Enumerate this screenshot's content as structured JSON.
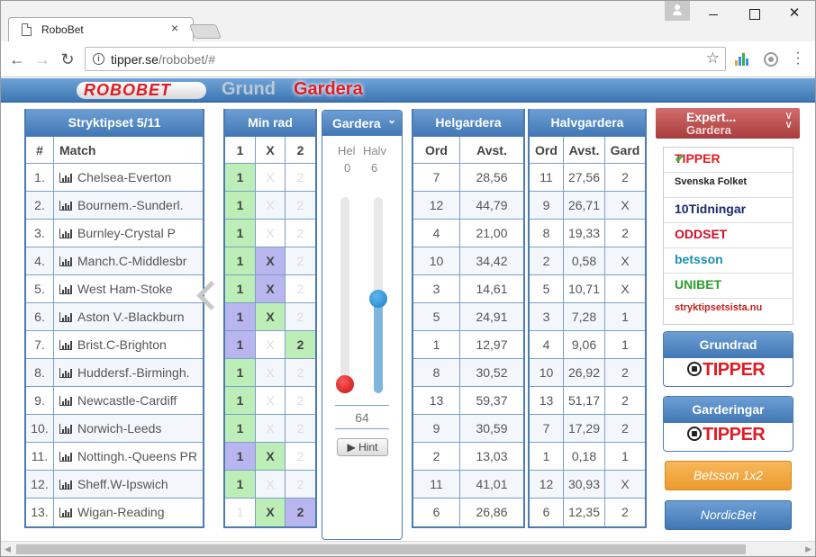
{
  "browser": {
    "tab_title": "RoboBet",
    "tab_close": "×",
    "url_domain": "tipper.se",
    "url_path": "/robobet/#",
    "win_close": "✕"
  },
  "header": {
    "logo": "ROBOBET",
    "mode_grund": "Grund",
    "mode_gardera": "Gardera"
  },
  "match_panel": {
    "title": "Stryktipset 5/11",
    "col_num": "#",
    "col_match": "Match",
    "rows": [
      {
        "num": "1.",
        "match": "Chelsea-Everton"
      },
      {
        "num": "2.",
        "match": "Bournem.-Sunderl."
      },
      {
        "num": "3.",
        "match": "Burnley-Crystal P"
      },
      {
        "num": "4.",
        "match": "Manch.C-Middlesbr"
      },
      {
        "num": "5.",
        "match": "West Ham-Stoke"
      },
      {
        "num": "6.",
        "match": "Aston V.-Blackburn"
      },
      {
        "num": "7.",
        "match": "Brist.C-Brighton"
      },
      {
        "num": "8.",
        "match": "Huddersf.-Birmingh."
      },
      {
        "num": "9.",
        "match": "Newcastle-Cardiff"
      },
      {
        "num": "10.",
        "match": "Norwich-Leeds"
      },
      {
        "num": "11.",
        "match": "Nottingh.-Queens PR"
      },
      {
        "num": "12.",
        "match": "Sheff.W-Ipswich"
      },
      {
        "num": "13.",
        "match": "Wigan-Reading"
      }
    ]
  },
  "minrad_panel": {
    "title": "Min rad",
    "cols": [
      "1",
      "X",
      "2"
    ],
    "rows": [
      [
        "g",
        "o",
        "o"
      ],
      [
        "g",
        "o",
        "o"
      ],
      [
        "g",
        "o",
        "o"
      ],
      [
        "g",
        "p",
        "o"
      ],
      [
        "g",
        "p",
        "o"
      ],
      [
        "p",
        "g",
        "o"
      ],
      [
        "p",
        "o",
        "g"
      ],
      [
        "g",
        "o",
        "o"
      ],
      [
        "g",
        "o",
        "o"
      ],
      [
        "g",
        "o",
        "o"
      ],
      [
        "p",
        "g",
        "o"
      ],
      [
        "g",
        "o",
        "o"
      ],
      [
        "o",
        "g",
        "p"
      ]
    ]
  },
  "gardera_slider": {
    "title": "Gardera",
    "chevron": "⌄",
    "hel_label": "Hel",
    "halv_label": "Halv",
    "hel_value": "0",
    "halv_value": "6",
    "hel_level": 0,
    "halv_level": 0.48,
    "total": "64",
    "hint_label": "▶ Hint"
  },
  "helgardera_panel": {
    "title": "Helgardera",
    "col_ord": "Ord",
    "col_avst": "Avst.",
    "rows": [
      [
        "7",
        "28,56"
      ],
      [
        "12",
        "44,79"
      ],
      [
        "4",
        "21,00"
      ],
      [
        "10",
        "34,42"
      ],
      [
        "3",
        "14,61"
      ],
      [
        "5",
        "24,91"
      ],
      [
        "1",
        "12,97"
      ],
      [
        "8",
        "30,52"
      ],
      [
        "13",
        "59,37"
      ],
      [
        "9",
        "30,59"
      ],
      [
        "2",
        "13,03"
      ],
      [
        "11",
        "41,01"
      ],
      [
        "6",
        "26,86"
      ]
    ]
  },
  "halvgardera_panel": {
    "title": "Halvgardera",
    "col_ord": "Ord",
    "col_avst": "Avst.",
    "col_gard": "Gard",
    "rows": [
      [
        "11",
        "27,56",
        "2"
      ],
      [
        "9",
        "26,71",
        "X"
      ],
      [
        "8",
        "19,33",
        "2"
      ],
      [
        "2",
        "0,58",
        "X"
      ],
      [
        "5",
        "10,71",
        "X"
      ],
      [
        "3",
        "7,28",
        "1"
      ],
      [
        "4",
        "9,06",
        "1"
      ],
      [
        "10",
        "26,92",
        "2"
      ],
      [
        "13",
        "51,17",
        "2"
      ],
      [
        "7",
        "17,29",
        "2"
      ],
      [
        "1",
        "0,18",
        "1"
      ],
      [
        "12",
        "30,93",
        "X"
      ],
      [
        "6",
        "12,35",
        "2"
      ]
    ]
  },
  "sidebar": {
    "expert_line1": "Expert...",
    "expert_line2": "Gardera",
    "expert_chevron": "︾",
    "sources": [
      {
        "label": "TIPPER",
        "color": "#e01c24",
        "selected": true
      },
      {
        "label": "Svenska Folket",
        "color": "#222222",
        "selected": false
      },
      {
        "label": "10Tidningar",
        "color": "#1a2a6c",
        "selected": false
      },
      {
        "label": "ODDSET",
        "color": "#d0102a",
        "selected": false
      },
      {
        "label": "betsson",
        "color": "#1b8fb8",
        "selected": false
      },
      {
        "label": "UNIBET",
        "color": "#2a9d2a",
        "selected": false
      },
      {
        "label": "stryktipsetsista.nu",
        "color": "#c81e1e",
        "selected": false
      }
    ],
    "check": "✔",
    "grundrad_title": "Grundrad",
    "grundrad_logo": "TIPPER",
    "garderingar_title": "Garderingar",
    "garderingar_logo": "TIPPER",
    "betsson_btn": "Betsson 1x2",
    "nordic_btn": "NordicBet"
  }
}
